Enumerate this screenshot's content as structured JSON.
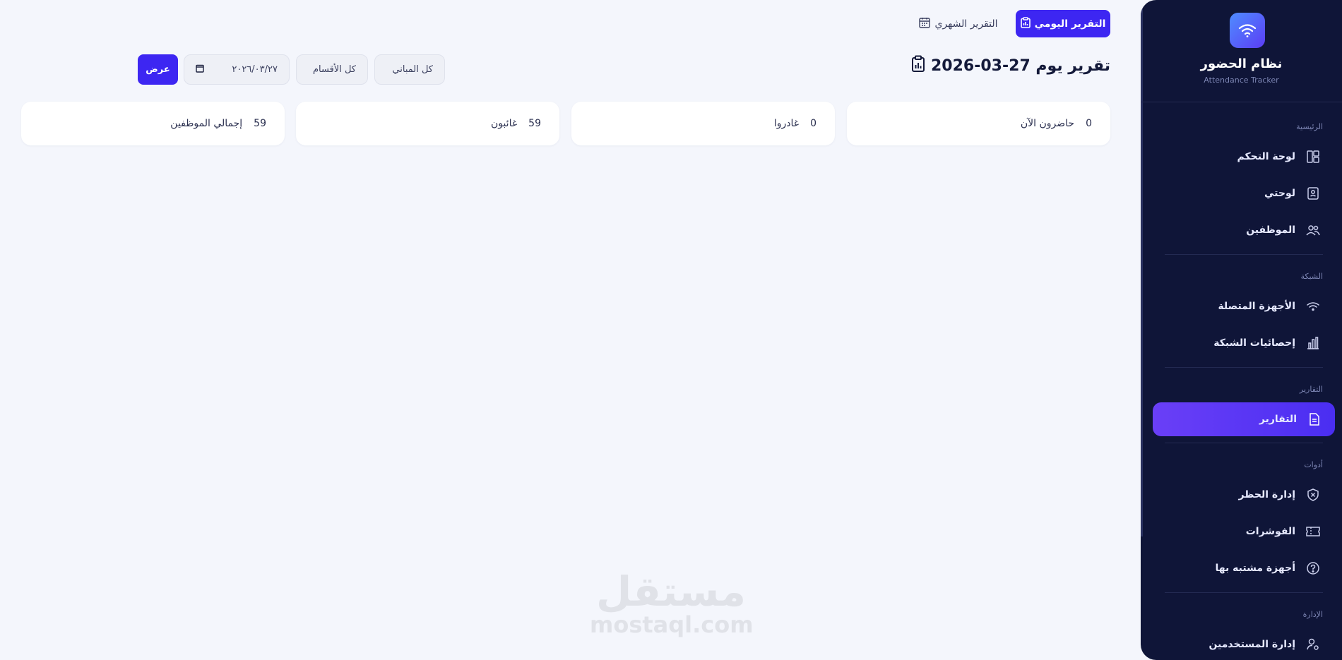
{
  "sidebar": {
    "brand_title": "نظام الحضور",
    "brand_subtitle": "Attendance Tracker",
    "sections": {
      "main": "الرئيسية",
      "network": "الشبكة",
      "reports": "التقارير",
      "tools": "أدوات",
      "admin": "الإدارة"
    },
    "items": [
      {
        "label": "لوحة التحكم",
        "icon": "dashboard-icon"
      },
      {
        "label": "لوحتي",
        "icon": "badge-icon"
      },
      {
        "label": "الموظفين",
        "icon": "users-icon"
      },
      {
        "label": "الأجهزة المتصلة",
        "icon": "wifi-icon"
      },
      {
        "label": "إحصائيات الشبكة",
        "icon": "bar-chart-icon"
      },
      {
        "label": "التقارير",
        "icon": "document-icon",
        "active": true
      },
      {
        "label": "إدارة الحظر",
        "icon": "shield-icon"
      },
      {
        "label": "الفوشرات",
        "icon": "ticket-icon"
      },
      {
        "label": "أجهزة مشتبه بها",
        "icon": "question-icon"
      },
      {
        "label": "إدارة المستخدمين",
        "icon": "user-gear-icon"
      }
    ]
  },
  "tabs": {
    "daily": "التقرير اليومي",
    "monthly": "التقرير الشهري"
  },
  "page_title": "تقرير يوم 27-03-2026",
  "filters": {
    "building": "كل المباني",
    "department": "كل الأقسام",
    "date": "٢٠٢٦/٠٣/٢٧",
    "show_button": "عرض"
  },
  "stats": [
    {
      "label": "حاضرون الآن",
      "value": "0"
    },
    {
      "label": "غادروا",
      "value": "0"
    },
    {
      "label": "غائبون",
      "value": "59"
    },
    {
      "label": "إجمالي الموظفين",
      "value": "59"
    }
  ],
  "watermark": {
    "arabic": "مستقل",
    "latin": "mostaql.com"
  },
  "colors": {
    "accent": "#3d26f2",
    "sidebar_bg": "#0f1538",
    "page_bg": "#f4f6fc"
  }
}
